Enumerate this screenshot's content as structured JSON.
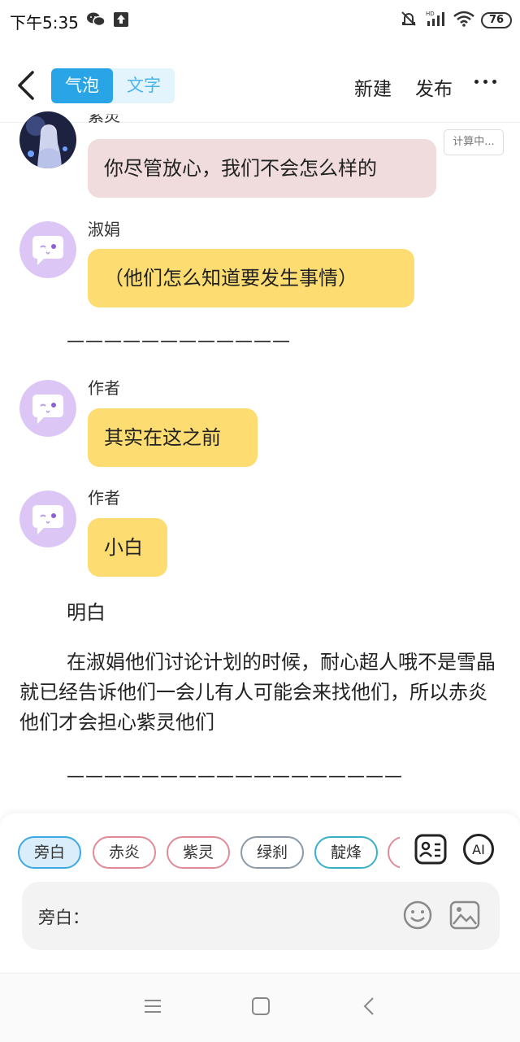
{
  "status": {
    "time": "下午5:35",
    "battery": "76"
  },
  "toolbar": {
    "tabs": [
      {
        "label": "气泡",
        "active": true
      },
      {
        "label": "文字",
        "active": false
      }
    ],
    "new_label": "新建",
    "publish_label": "发布"
  },
  "messages": [
    {
      "name": "紫灵",
      "text": "你尽管放心，我们不会怎么样的",
      "status": "计算中..."
    },
    {
      "name": "淑娟",
      "text": "（他们怎么知道要发生事情）"
    },
    {
      "divider": "————————————"
    },
    {
      "name": "作者",
      "text": "其实在这之前"
    },
    {
      "name": "作者",
      "text": "小白"
    }
  ],
  "narration": {
    "line1": "明白",
    "paragraph": "在淑娟他们讨论计划的时候，耐心超人哦不是雪晶就已经告诉他们一会儿有人可能会来找他们，所以赤炎他们才会担心紫灵他们",
    "divider": "——————————————————"
  },
  "panel": {
    "roles": [
      "旁白",
      "赤炎",
      "紫灵",
      "绿刹",
      "靛烽"
    ],
    "role_colors": [
      "#3ca9e4",
      "#e08a9a",
      "#e08a9a",
      "#8a9aa8",
      "#3ab0c4"
    ],
    "ai_label": "AI",
    "input_label": "旁白："
  },
  "colors": {
    "accent": "#29a4e6",
    "bubble_yellow": "#fddd71",
    "bubble_pink": "#f0dcdd",
    "avatar_purple": "#dcc6f6"
  }
}
